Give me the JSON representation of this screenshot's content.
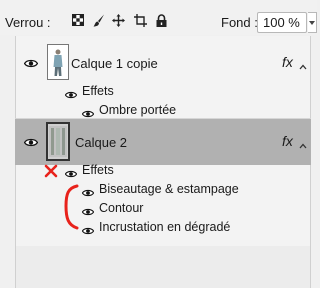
{
  "toolbar": {
    "lock_label": "Verrou :",
    "lock_icons": [
      "lock-transparent-pixels-icon",
      "lock-image-pixels-icon",
      "lock-position-icon",
      "lock-artboard-icon",
      "lock-all-icon"
    ],
    "fond_label": "Fond :",
    "fond_value": "100 %"
  },
  "layers": [
    {
      "name": "Calque 1 copie",
      "fx": "fx",
      "effects_label": "Effets",
      "effects": [
        "Ombre portée"
      ],
      "selected": false
    },
    {
      "name": "Calque 2",
      "fx": "fx",
      "effects_label": "Effets",
      "effects": [
        "Biseautage & estampage",
        "Contour",
        "Incrustation en dégradé"
      ],
      "selected": true
    }
  ],
  "annotations": {
    "mark_color": "#e8221b",
    "marks": [
      "cross-mark",
      "bracket-mark"
    ]
  },
  "colors": {
    "selected_row": "#b1b1b1",
    "panel_bg": "#f3f3f3"
  }
}
